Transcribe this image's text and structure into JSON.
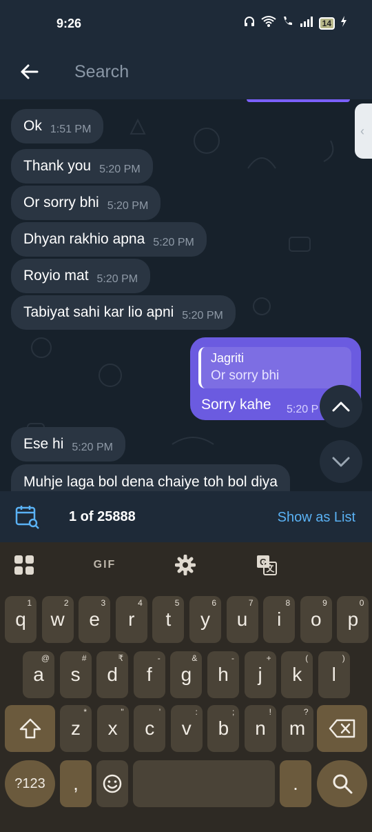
{
  "status_bar": {
    "time": "9:26",
    "battery": "14"
  },
  "header": {
    "search_placeholder": "Search"
  },
  "messages_in": [
    {
      "text": "Ok",
      "time": "1:51 PM"
    },
    {
      "text": "Thank you",
      "time": "5:20 PM"
    },
    {
      "text": "Or sorry bhi",
      "time": "5:20 PM"
    },
    {
      "text": "Dhyan rakhio apna",
      "time": "5:20 PM"
    },
    {
      "text": "Royio mat",
      "time": "5:20 PM"
    },
    {
      "text": "Tabiyat sahi kar lio apni",
      "time": "5:20 PM"
    }
  ],
  "message_out": {
    "reply_name": "Jagriti",
    "reply_text": "Or sorry bhi",
    "text": "Sorry kahe",
    "time": "5:20 P"
  },
  "messages_in_2": [
    {
      "text": "Ese hi",
      "time": "5:20 PM"
    },
    {
      "text": "Muhje laga bol dena chaiye toh bol diya"
    }
  ],
  "search_bar": {
    "count": "1 of 25888",
    "show_as_list": "Show as List"
  },
  "keyboard": {
    "tools": {
      "gif": "GIF"
    },
    "row1": [
      {
        "k": "q",
        "h": "1"
      },
      {
        "k": "w",
        "h": "2"
      },
      {
        "k": "e",
        "h": "3"
      },
      {
        "k": "r",
        "h": "4"
      },
      {
        "k": "t",
        "h": "5"
      },
      {
        "k": "y",
        "h": "6"
      },
      {
        "k": "u",
        "h": "7"
      },
      {
        "k": "i",
        "h": "8"
      },
      {
        "k": "o",
        "h": "9"
      },
      {
        "k": "p",
        "h": "0"
      }
    ],
    "row2": [
      {
        "k": "a",
        "h": "@"
      },
      {
        "k": "s",
        "h": "#"
      },
      {
        "k": "d",
        "h": "₹"
      },
      {
        "k": "f",
        "h": "-"
      },
      {
        "k": "g",
        "h": "&"
      },
      {
        "k": "h",
        "h": "-"
      },
      {
        "k": "j",
        "h": "+"
      },
      {
        "k": "k",
        "h": "("
      },
      {
        "k": "l",
        "h": ")"
      }
    ],
    "row3": [
      {
        "k": "z",
        "h": "*"
      },
      {
        "k": "x",
        "h": "\""
      },
      {
        "k": "c",
        "h": "'"
      },
      {
        "k": "v",
        "h": ":"
      },
      {
        "k": "b",
        "h": ";"
      },
      {
        "k": "n",
        "h": "!"
      },
      {
        "k": "m",
        "h": "?"
      }
    ],
    "symbols_label": "?123",
    "comma": ",",
    "period": "."
  },
  "colors": {
    "accent": "#6b5be0",
    "link": "#5ab2f5",
    "chat_bg": "#17212b",
    "bubble_in": "#2a3542"
  }
}
